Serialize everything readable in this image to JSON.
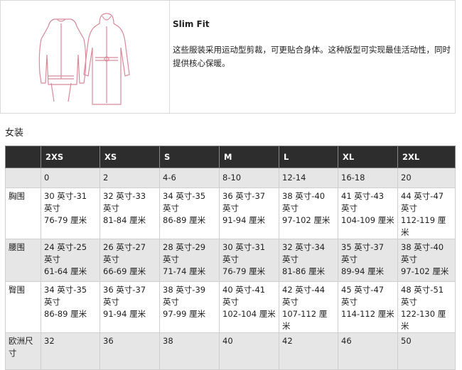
{
  "fit": {
    "title": "Slim Fit",
    "description": "这些服装采用运动型剪裁，可更贴合身体。这种版型可实现最佳活动性，同时提供核心保暖。"
  },
  "section_title": "女装",
  "table": {
    "sizes": [
      "2XS",
      "XS",
      "S",
      "M",
      "L",
      "XL",
      "2XL"
    ],
    "numeric": [
      "0",
      "2",
      "4-6",
      "8-10",
      "12-14",
      "16-18",
      "20"
    ],
    "rows": [
      {
        "label": "胸围",
        "cells": [
          [
            "30 英寸-31 英寸",
            "76-79 厘米"
          ],
          [
            "32 英寸-33 英寸",
            "81-84 厘米"
          ],
          [
            "34 英寸-35 英寸",
            "86-89 厘米"
          ],
          [
            "36 英寸-37 英寸",
            "91-94 厘米"
          ],
          [
            "38 英寸-40 英寸",
            "97-102 厘米"
          ],
          [
            "41 英寸-43 英寸",
            "104-109 厘米"
          ],
          [
            "44 英寸-47 英寸",
            "112-119 厘米"
          ]
        ]
      },
      {
        "label": "腰围",
        "cells": [
          [
            "24 英寸-25 英寸",
            "61-64 厘米"
          ],
          [
            "26 英寸-27 英寸",
            "66-69 厘米"
          ],
          [
            "28 英寸-29 英寸",
            "71-74 厘米"
          ],
          [
            "30 英寸-31 英寸",
            "76-79 厘米"
          ],
          [
            "32 英寸-34 英寸",
            "81-86 厘米"
          ],
          [
            "35 英寸-37 英寸",
            "89-94 厘米"
          ],
          [
            "38 英寸-40 英寸",
            "97-102 厘米"
          ]
        ]
      },
      {
        "label": "臀围",
        "cells": [
          [
            "34 英寸-35 英寸",
            "86-89 厘米"
          ],
          [
            "36 英寸-37 英寸",
            "91-94 厘米"
          ],
          [
            "38 英寸-39 英寸",
            "97-99 厘米"
          ],
          [
            "40 英寸-41 英寸",
            "102-104 厘米"
          ],
          [
            "42 英寸-44 英寸",
            "107-112 厘米"
          ],
          [
            "45 英寸-47 英寸",
            "114-112 厘米"
          ],
          [
            "48 英寸-51 英寸",
            "122-130 厘米"
          ]
        ]
      }
    ],
    "eu": {
      "label": "欧洲尺寸",
      "values": [
        "32",
        "36",
        "38",
        "40",
        "42",
        "46",
        "50"
      ]
    }
  },
  "colors": {
    "header_bg": "#2d2d2d",
    "shade": "#e6e6e6",
    "illustration": "#d98a9a"
  }
}
